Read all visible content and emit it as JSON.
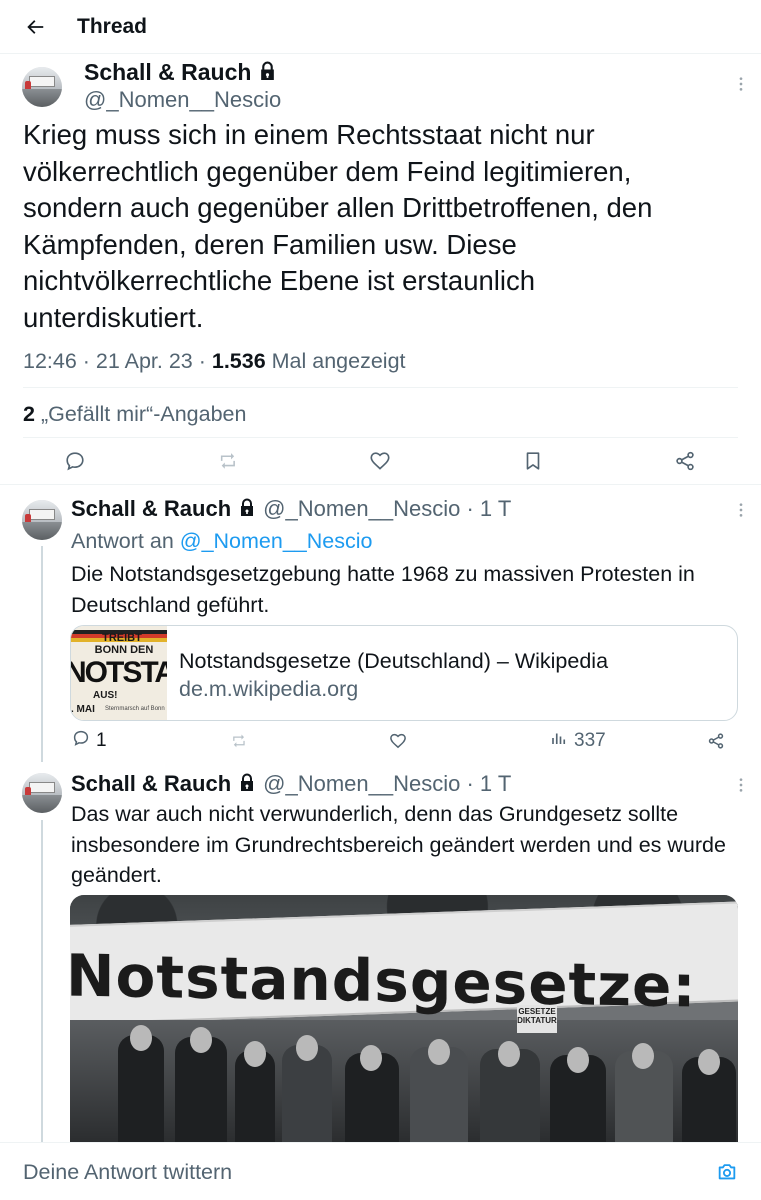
{
  "header": {
    "title": "Thread"
  },
  "main_tweet": {
    "author_name": "Schall & Rauch",
    "handle": "@_Nomen__Nescio",
    "text": "Krieg muss sich in einem Rechtsstaat nicht nur völkerrechtlich gegenüber dem Feind legitimieren, sondern auch gegenüber allen Drittbetroffenen, den Kämpfenden, deren Familien usw. Diese nichtvölkerrechtliche Ebene ist erstaunlich unterdiskutiert.",
    "time_date": "12:46 · 21 Apr. 23 · ",
    "views_count": "1.536",
    "views_label": " Mal angezeigt",
    "likes_count": "2",
    "likes_label": " „Gefällt mir“-Angaben"
  },
  "replies": [
    {
      "author_name": "Schall & Rauch",
      "handle_time": "@_Nomen__Nescio · 1 T",
      "reply_to_label": "Antwort an ",
      "reply_to_handle": "@_Nomen__Nescio",
      "text": "Die Notstandsgesetzgebung hatte 1968 zu massiven Protesten in Deutschland geführt.",
      "link_card": {
        "title": "Notstandsgesetze (Deutschland) – Wikipedia",
        "domain": "de.m.wikipedia.org",
        "thumb_line1": "TREIBT",
        "thumb_line2": "BONN DEN",
        "thumb_big": "NOTSTAND",
        "thumb_line3": "AUS!",
        "thumb_line4": ". MAI",
        "thumb_line5": "Sternmarsch auf Bonn"
      },
      "reply_count": "1",
      "view_count": "337"
    },
    {
      "author_name": "Schall & Rauch",
      "handle_time": "@_Nomen__Nescio · 1 T",
      "text": "Das war auch nicht verwunderlich, denn das Grundgesetz sollte insbesondere im Grundrechtsbereich geändert werden und es wurde geändert.",
      "photo_banner_text": "Notstandsgesetze:",
      "photo_sign_text": "GESETZE DIKTATUR"
    }
  ],
  "compose": {
    "placeholder": "Deine Antwort twittern"
  },
  "colors": {
    "accent": "#1d9bf0",
    "secondary_text": "#536471",
    "divider": "#eff3f4"
  }
}
